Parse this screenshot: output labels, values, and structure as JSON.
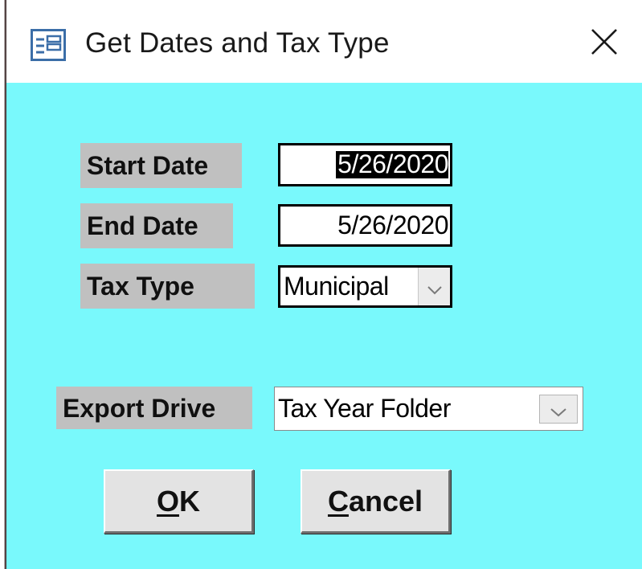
{
  "window": {
    "title": "Get Dates and Tax Type",
    "title_icon": "form-icon",
    "close_icon": "close-icon"
  },
  "form": {
    "start_date": {
      "label": "Start Date",
      "value": "5/26/2020"
    },
    "end_date": {
      "label": "End Date",
      "value": "5/26/2020"
    },
    "tax_type": {
      "label": "Tax Type",
      "value": "Municipal"
    },
    "export_drive": {
      "label": "Export Drive",
      "value": "Tax Year Folder"
    }
  },
  "buttons": {
    "ok": {
      "accel": "O",
      "rest": "K"
    },
    "cancel": {
      "accel": "C",
      "rest": "ancel"
    }
  },
  "colors": {
    "client_background": "#79f9fc",
    "label_background": "#c0c0c0",
    "button_face": "#e3e3e3"
  }
}
